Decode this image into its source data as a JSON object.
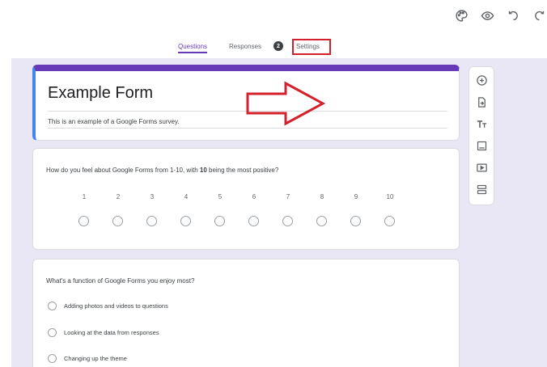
{
  "colors": {
    "accent": "#673ab7",
    "highlight": "#d3202a",
    "canvas": "#e9e7f5"
  },
  "header": {
    "icons": [
      "palette-icon",
      "eye-icon",
      "undo-icon",
      "redo-icon"
    ],
    "tabs": [
      {
        "label": "Questions",
        "active": true
      },
      {
        "label": "Responses"
      },
      {
        "label": "Settings"
      }
    ],
    "responses_badge": "2"
  },
  "form": {
    "title": "Example Form",
    "description": "This is an example of a Google Forms survey."
  },
  "question1": {
    "text_before": "How do you feel about Google Forms from 1-10, with ",
    "text_bold": "10",
    "text_after": " being the most positive?",
    "scale": [
      "1",
      "2",
      "3",
      "4",
      "5",
      "6",
      "7",
      "8",
      "9",
      "10"
    ]
  },
  "question2": {
    "text": "What's a function of Google Forms you enjoy most?",
    "options": [
      "Adding photos and videos to questions",
      "Looking at the data from responses",
      "Changing up the theme"
    ]
  },
  "sidebar": {
    "icons": [
      "add-question-icon",
      "import-questions-icon",
      "add-title-icon",
      "add-image-icon",
      "add-video-icon",
      "add-section-icon"
    ]
  }
}
